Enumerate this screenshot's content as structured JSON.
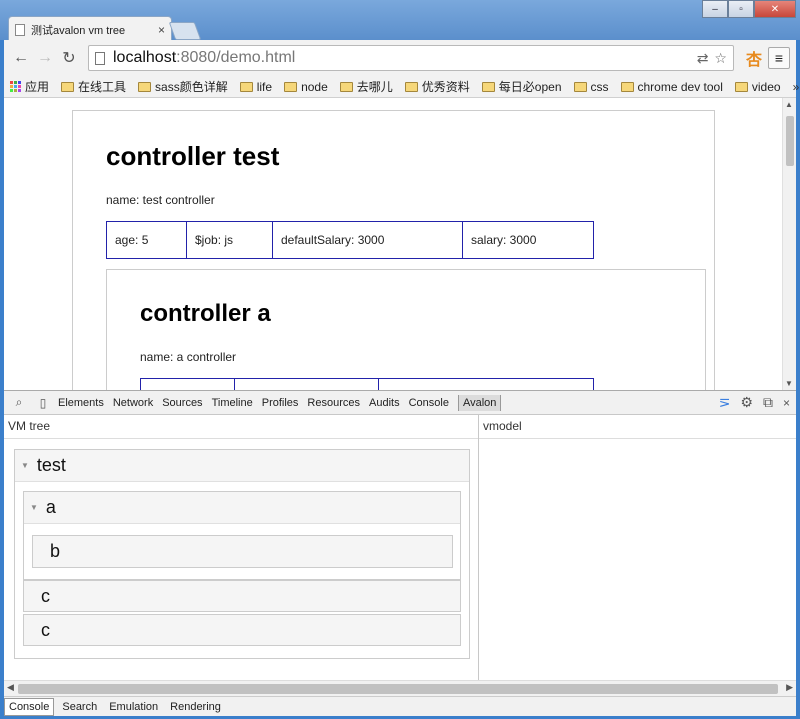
{
  "browser": {
    "tab_title": "测试avalon vm tree",
    "tab_close": "×",
    "url_host": "localhost",
    "url_rest": ":8080/demo.html",
    "win_minimize": "–",
    "win_maximize": "▫",
    "win_close": "✕",
    "back": "←",
    "forward": "→",
    "reload": "↻",
    "translate": "⇄",
    "star": "☆",
    "ext": "杏",
    "menu": "≡"
  },
  "bookmarks": {
    "items": [
      "应用",
      "在线工具",
      "sass颜色详解",
      "life",
      "node",
      "去哪儿",
      "优秀资料",
      "每日必open",
      "css",
      "chrome dev tool",
      "video"
    ],
    "more": "»"
  },
  "page": {
    "outer": {
      "title": "controller test",
      "name": "name: test controller",
      "props": [
        "age: 5",
        "$job: js",
        "defaultSalary: 3000",
        "salary: 3000"
      ]
    },
    "inner": {
      "title": "controller a",
      "name": "name: a controller",
      "props": [
        "",
        "",
        ""
      ]
    }
  },
  "devtools": {
    "tabs": [
      "Elements",
      "Network",
      "Sources",
      "Timeline",
      "Profiles",
      "Resources",
      "Audits",
      "Console",
      "Avalon"
    ],
    "active_tab": "Avalon",
    "left_title": "VM tree",
    "right_title": "vmodel",
    "tree": {
      "root": "test",
      "child_a": "a",
      "child_b": "b",
      "child_c1": "c",
      "child_c2": "c"
    },
    "drawer_tabs": [
      "Console",
      "Search",
      "Emulation",
      "Rendering"
    ]
  }
}
